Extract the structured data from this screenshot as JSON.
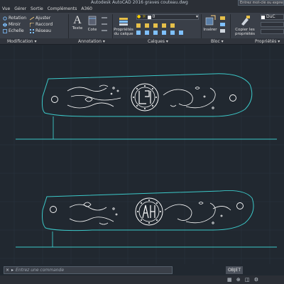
{
  "app": {
    "title": "Autodesk AutoCAD 2016",
    "document": "graves couteau.dwg",
    "search_placeholder": "Entrez mot-clé ou expression"
  },
  "menu": [
    "Vue",
    "Gérer",
    "Sortie",
    "Compléments",
    "A360"
  ],
  "ribbon": {
    "modification": {
      "label": "Modification",
      "buttons": [
        "Rotation",
        "Ajuster",
        "Miroir",
        "Raccord",
        "Echelle",
        "Réseau"
      ]
    },
    "annotation": {
      "label": "Annotation",
      "buttons": [
        "Texte",
        "Cote"
      ]
    },
    "calques": {
      "label": "Calques",
      "properties_label": "Propriétés du calque",
      "layer_value": "0"
    },
    "bloc": {
      "label": "Bloc",
      "insert_label": "Insérer"
    },
    "proprietes": {
      "label": "Propriétés",
      "copy_label": "Copier les propriétés",
      "color_value": "DuC"
    }
  },
  "command": {
    "placeholder": "Entrez une commande"
  },
  "status": {
    "objet_label": "OBJET"
  },
  "colors": {
    "background": "#212830",
    "outline": "#3cc9c9",
    "engraving": "#ffffff",
    "ribbon": "#3a3f48"
  }
}
